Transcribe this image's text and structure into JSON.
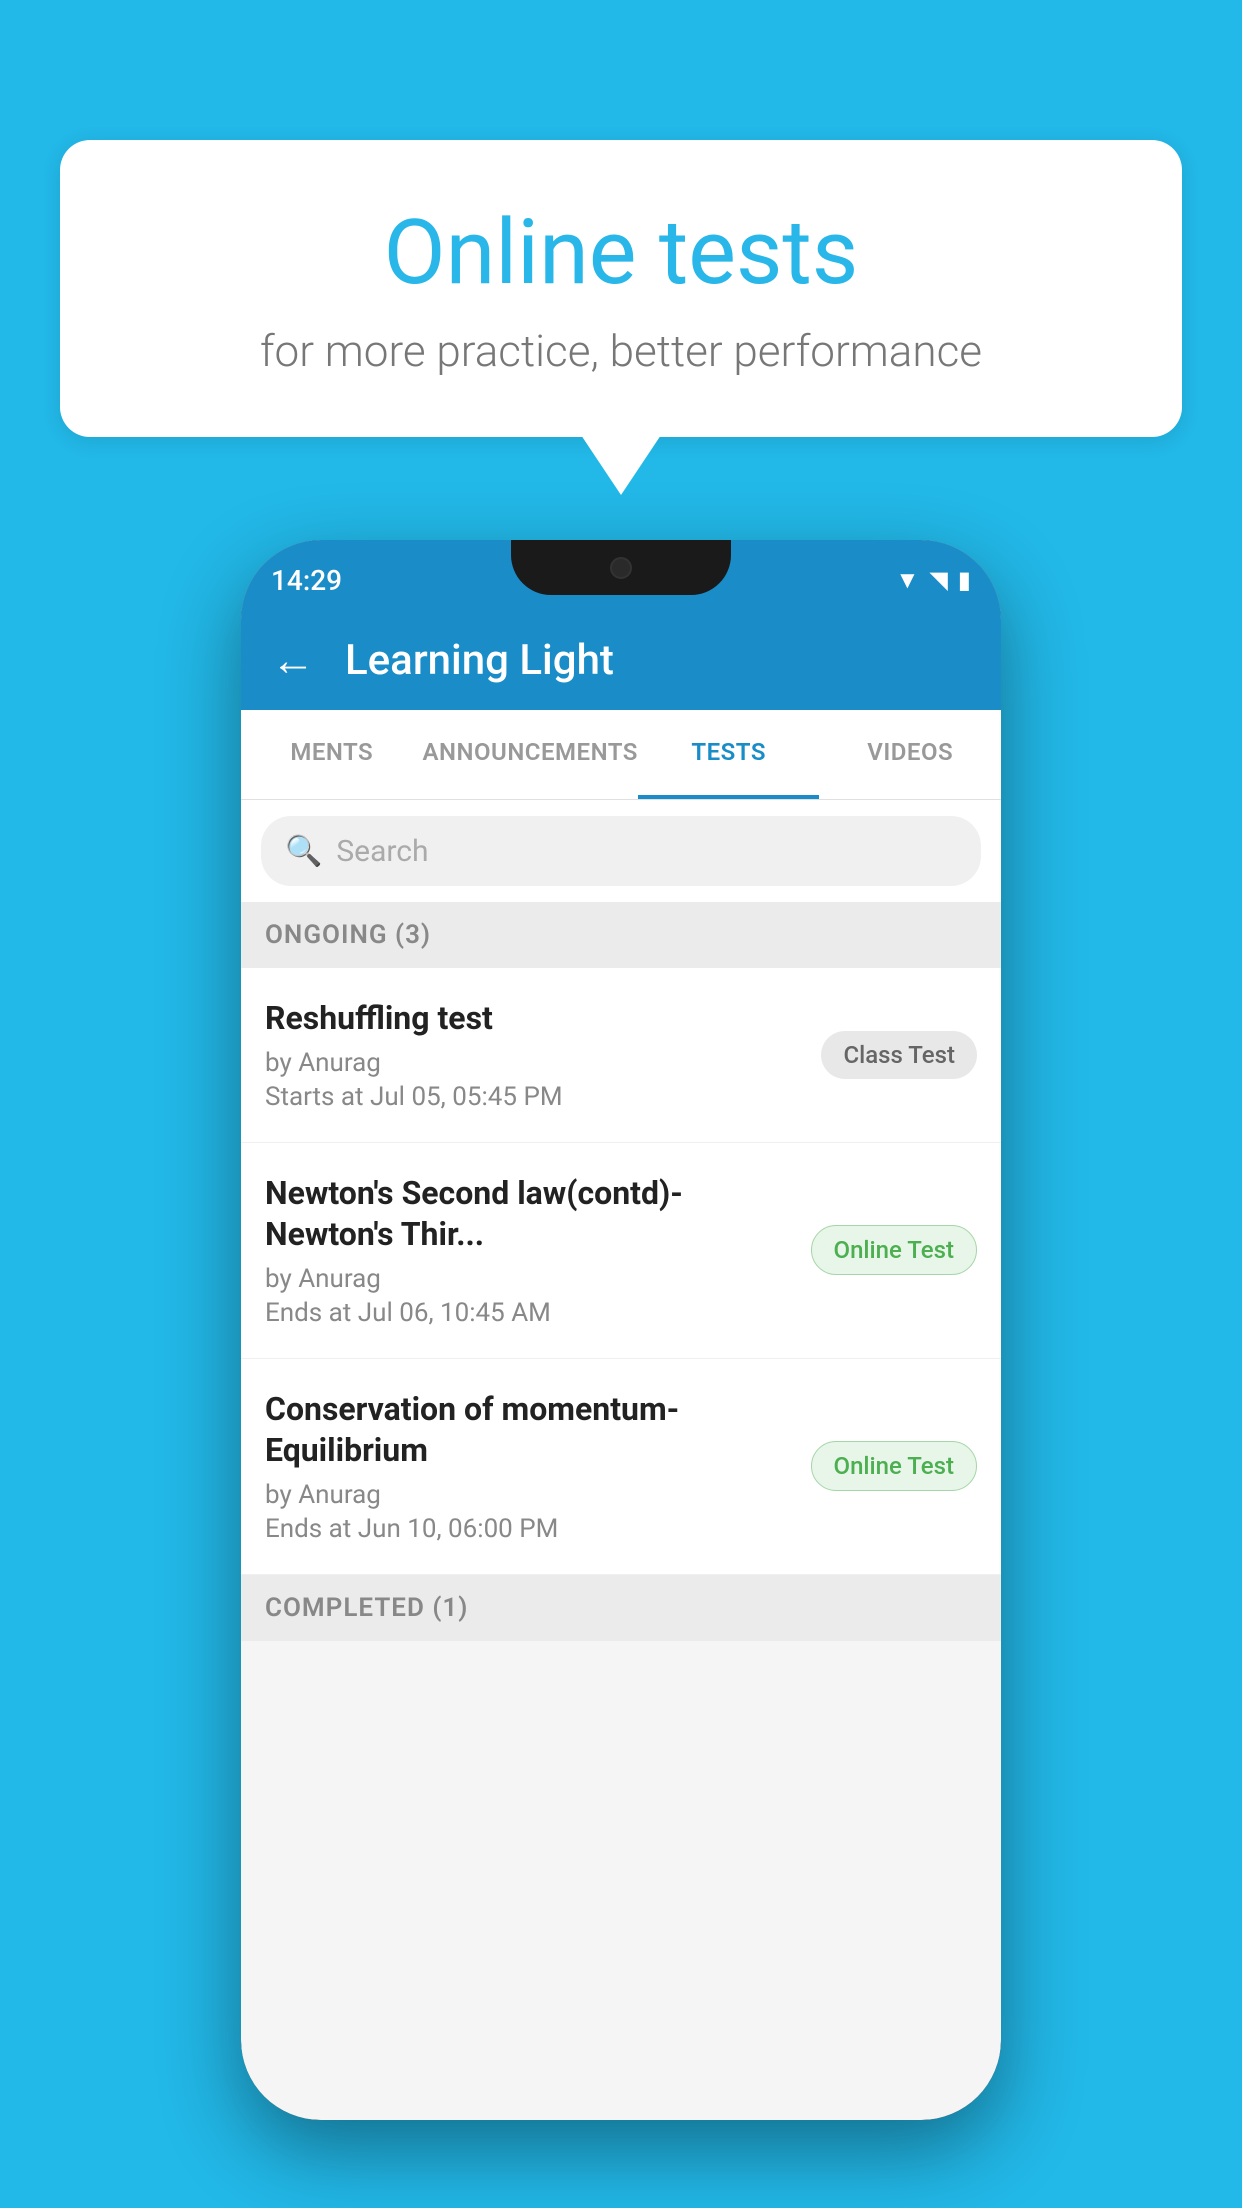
{
  "background": {
    "color": "#22b8e8"
  },
  "speechBubble": {
    "title": "Online tests",
    "subtitle": "for more practice, better performance"
  },
  "phone": {
    "statusBar": {
      "time": "14:29"
    },
    "appBar": {
      "backLabel": "←",
      "title": "Learning Light"
    },
    "tabs": [
      {
        "label": "MENTS",
        "active": false
      },
      {
        "label": "ANNOUNCEMENTS",
        "active": false
      },
      {
        "label": "TESTS",
        "active": true
      },
      {
        "label": "VIDEOS",
        "active": false
      }
    ],
    "search": {
      "placeholder": "Search"
    },
    "ongoingSection": {
      "label": "ONGOING (3)"
    },
    "tests": [
      {
        "title": "Reshuffling test",
        "author": "by Anurag",
        "time": "Starts at  Jul 05, 05:45 PM",
        "badge": "Class Test",
        "badgeType": "class"
      },
      {
        "title": "Newton's Second law(contd)-Newton's Thir...",
        "author": "by Anurag",
        "time": "Ends at  Jul 06, 10:45 AM",
        "badge": "Online Test",
        "badgeType": "online"
      },
      {
        "title": "Conservation of momentum-Equilibrium",
        "author": "by Anurag",
        "time": "Ends at  Jun 10, 06:00 PM",
        "badge": "Online Test",
        "badgeType": "online"
      }
    ],
    "completedSection": {
      "label": "COMPLETED (1)"
    }
  }
}
